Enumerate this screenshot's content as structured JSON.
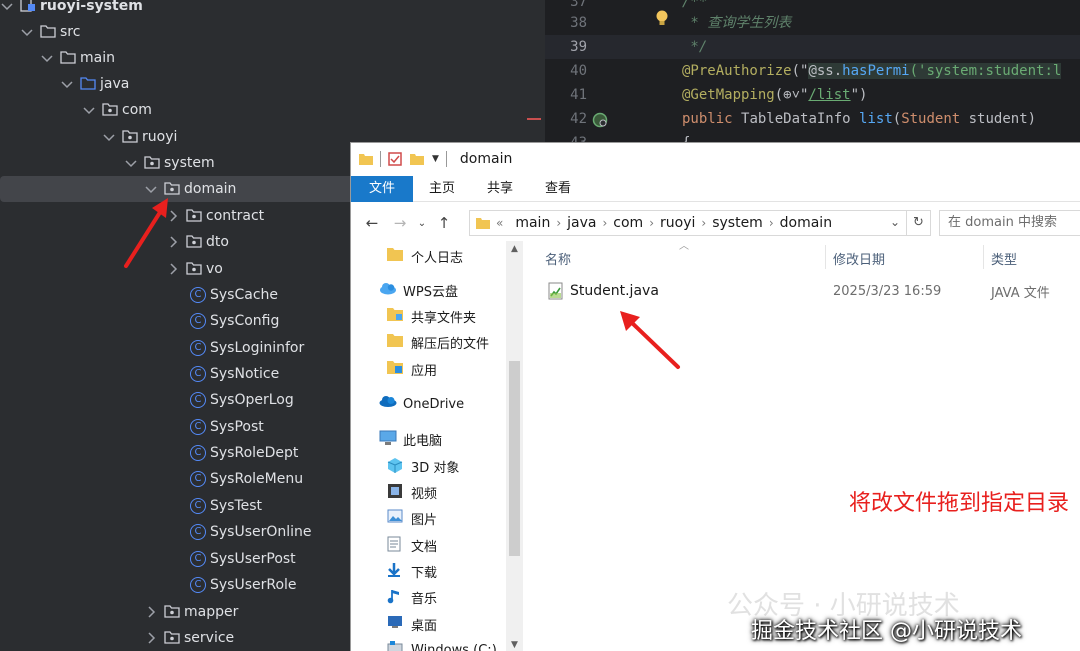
{
  "tree": {
    "items": [
      {
        "label": "ruoyi-system",
        "kind": "module"
      },
      {
        "label": "src",
        "kind": "folder"
      },
      {
        "label": "main",
        "kind": "folder"
      },
      {
        "label": "java",
        "kind": "source-root"
      },
      {
        "label": "com",
        "kind": "package"
      },
      {
        "label": "ruoyi",
        "kind": "package"
      },
      {
        "label": "system",
        "kind": "package"
      },
      {
        "label": "domain",
        "kind": "package",
        "selected": true
      },
      {
        "label": "contract",
        "kind": "package"
      },
      {
        "label": "dto",
        "kind": "package"
      },
      {
        "label": "vo",
        "kind": "package"
      },
      {
        "label": "SysCache",
        "kind": "class"
      },
      {
        "label": "SysConfig",
        "kind": "class"
      },
      {
        "label": "SysLogininfor",
        "kind": "class"
      },
      {
        "label": "SysNotice",
        "kind": "class"
      },
      {
        "label": "SysOperLog",
        "kind": "class"
      },
      {
        "label": "SysPost",
        "kind": "class"
      },
      {
        "label": "SysRoleDept",
        "kind": "class"
      },
      {
        "label": "SysRoleMenu",
        "kind": "class"
      },
      {
        "label": "SysTest",
        "kind": "class"
      },
      {
        "label": "SysUserOnline",
        "kind": "class"
      },
      {
        "label": "SysUserPost",
        "kind": "class"
      },
      {
        "label": "SysUserRole",
        "kind": "class"
      },
      {
        "label": "mapper",
        "kind": "package"
      },
      {
        "label": "service",
        "kind": "package"
      }
    ],
    "class_icon_letter": "C"
  },
  "editor": {
    "lines": [
      {
        "num": "37",
        "parts": [
          [
            "cmt",
            "/**"
          ]
        ]
      },
      {
        "num": "38",
        "parts": [
          [
            "cmt",
            " * 查询学生列表"
          ]
        ]
      },
      {
        "num": "39",
        "parts": [
          [
            "cmt",
            " */"
          ]
        ],
        "current": true
      },
      {
        "num": "40",
        "parts": [
          [
            "ann",
            "@PreAuthorize"
          ],
          [
            "txt",
            "(\""
          ],
          [
            "hl",
            "@ss."
          ],
          [
            "fnhl",
            "hasPermi"
          ],
          [
            "strhl",
            "('system:student:l"
          ]
        ]
      },
      {
        "num": "41",
        "parts": [
          [
            "ann",
            "@GetMapping"
          ],
          [
            "txt",
            "(⊕˅\""
          ],
          [
            "tag",
            "/list"
          ],
          [
            "txt",
            "\")"
          ]
        ]
      },
      {
        "num": "42",
        "parts": [
          [
            "kw",
            "public "
          ],
          [
            "txt",
            "TableDataInfo "
          ],
          [
            "fn",
            "list"
          ],
          [
            "txt",
            "("
          ],
          [
            "kw",
            "Student "
          ],
          [
            "txt",
            "student)"
          ]
        ]
      },
      {
        "num": "43",
        "parts": [
          [
            "txt",
            "{"
          ]
        ]
      }
    ]
  },
  "explorer": {
    "title": "domain",
    "ribbon_tabs": [
      "文件",
      "主页",
      "共享",
      "查看"
    ],
    "breadcrumb": [
      "main",
      "java",
      "com",
      "ruoyi",
      "system",
      "domain"
    ],
    "breadcrumb_prefix": "«",
    "search_placeholder": "在 domain 中搜索",
    "nav_items": [
      {
        "label": "个人日志",
        "icon": "folder-icon"
      },
      {
        "label": "WPS云盘",
        "icon": "cloud-icon"
      },
      {
        "label": "共享文件夹",
        "icon": "shared-folder-icon"
      },
      {
        "label": "解压后的文件",
        "icon": "folder-icon"
      },
      {
        "label": "应用",
        "icon": "app-folder-icon"
      },
      {
        "label": "OneDrive",
        "icon": "onedrive-icon"
      },
      {
        "label": "此电脑",
        "icon": "computer-icon"
      },
      {
        "label": "3D 对象",
        "icon": "3d-objects-icon"
      },
      {
        "label": "视频",
        "icon": "video-icon"
      },
      {
        "label": "图片",
        "icon": "pictures-icon"
      },
      {
        "label": "文档",
        "icon": "documents-icon"
      },
      {
        "label": "下载",
        "icon": "download-icon"
      },
      {
        "label": "音乐",
        "icon": "music-icon"
      },
      {
        "label": "桌面",
        "icon": "desktop-icon"
      },
      {
        "label": "Windows (C:)",
        "icon": "drive-icon"
      }
    ],
    "columns": [
      "名称",
      "修改日期",
      "类型"
    ],
    "files": [
      {
        "name": "Student.java",
        "modified": "2025/3/23 16:59",
        "type": "JAVA 文件"
      }
    ],
    "annotation": "将改文件拖到指定目录"
  },
  "watermark": {
    "line1": "公众号 · 小研说技术",
    "line2": "掘金技术社区 @小研说技术"
  },
  "colors": {
    "ide_bg": "#2b2d30",
    "editor_bg": "#1e1f22",
    "ribbon_file_tab": "#1979ca",
    "annotation_red": "#e8201e"
  }
}
